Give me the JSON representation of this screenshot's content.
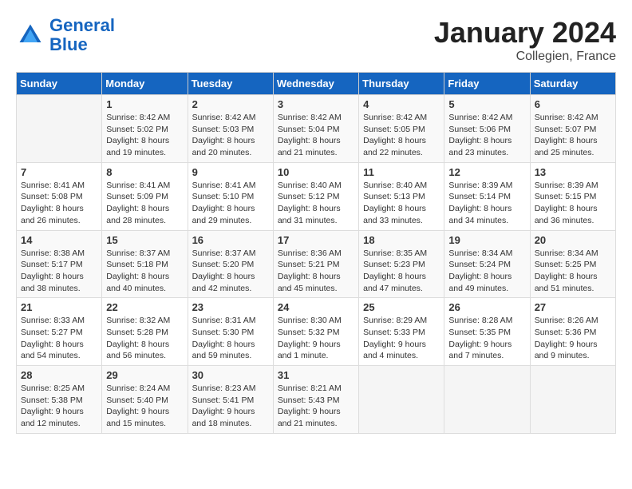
{
  "header": {
    "logo_line1": "General",
    "logo_line2": "Blue",
    "month_year": "January 2024",
    "location": "Collegien, France"
  },
  "days_of_week": [
    "Sunday",
    "Monday",
    "Tuesday",
    "Wednesday",
    "Thursday",
    "Friday",
    "Saturday"
  ],
  "weeks": [
    [
      {
        "day": "",
        "sunrise": "",
        "sunset": "",
        "daylight": ""
      },
      {
        "day": "1",
        "sunrise": "Sunrise: 8:42 AM",
        "sunset": "Sunset: 5:02 PM",
        "daylight": "Daylight: 8 hours and 19 minutes."
      },
      {
        "day": "2",
        "sunrise": "Sunrise: 8:42 AM",
        "sunset": "Sunset: 5:03 PM",
        "daylight": "Daylight: 8 hours and 20 minutes."
      },
      {
        "day": "3",
        "sunrise": "Sunrise: 8:42 AM",
        "sunset": "Sunset: 5:04 PM",
        "daylight": "Daylight: 8 hours and 21 minutes."
      },
      {
        "day": "4",
        "sunrise": "Sunrise: 8:42 AM",
        "sunset": "Sunset: 5:05 PM",
        "daylight": "Daylight: 8 hours and 22 minutes."
      },
      {
        "day": "5",
        "sunrise": "Sunrise: 8:42 AM",
        "sunset": "Sunset: 5:06 PM",
        "daylight": "Daylight: 8 hours and 23 minutes."
      },
      {
        "day": "6",
        "sunrise": "Sunrise: 8:42 AM",
        "sunset": "Sunset: 5:07 PM",
        "daylight": "Daylight: 8 hours and 25 minutes."
      }
    ],
    [
      {
        "day": "7",
        "sunrise": "Sunrise: 8:41 AM",
        "sunset": "Sunset: 5:08 PM",
        "daylight": "Daylight: 8 hours and 26 minutes."
      },
      {
        "day": "8",
        "sunrise": "Sunrise: 8:41 AM",
        "sunset": "Sunset: 5:09 PM",
        "daylight": "Daylight: 8 hours and 28 minutes."
      },
      {
        "day": "9",
        "sunrise": "Sunrise: 8:41 AM",
        "sunset": "Sunset: 5:10 PM",
        "daylight": "Daylight: 8 hours and 29 minutes."
      },
      {
        "day": "10",
        "sunrise": "Sunrise: 8:40 AM",
        "sunset": "Sunset: 5:12 PM",
        "daylight": "Daylight: 8 hours and 31 minutes."
      },
      {
        "day": "11",
        "sunrise": "Sunrise: 8:40 AM",
        "sunset": "Sunset: 5:13 PM",
        "daylight": "Daylight: 8 hours and 33 minutes."
      },
      {
        "day": "12",
        "sunrise": "Sunrise: 8:39 AM",
        "sunset": "Sunset: 5:14 PM",
        "daylight": "Daylight: 8 hours and 34 minutes."
      },
      {
        "day": "13",
        "sunrise": "Sunrise: 8:39 AM",
        "sunset": "Sunset: 5:15 PM",
        "daylight": "Daylight: 8 hours and 36 minutes."
      }
    ],
    [
      {
        "day": "14",
        "sunrise": "Sunrise: 8:38 AM",
        "sunset": "Sunset: 5:17 PM",
        "daylight": "Daylight: 8 hours and 38 minutes."
      },
      {
        "day": "15",
        "sunrise": "Sunrise: 8:37 AM",
        "sunset": "Sunset: 5:18 PM",
        "daylight": "Daylight: 8 hours and 40 minutes."
      },
      {
        "day": "16",
        "sunrise": "Sunrise: 8:37 AM",
        "sunset": "Sunset: 5:20 PM",
        "daylight": "Daylight: 8 hours and 42 minutes."
      },
      {
        "day": "17",
        "sunrise": "Sunrise: 8:36 AM",
        "sunset": "Sunset: 5:21 PM",
        "daylight": "Daylight: 8 hours and 45 minutes."
      },
      {
        "day": "18",
        "sunrise": "Sunrise: 8:35 AM",
        "sunset": "Sunset: 5:23 PM",
        "daylight": "Daylight: 8 hours and 47 minutes."
      },
      {
        "day": "19",
        "sunrise": "Sunrise: 8:34 AM",
        "sunset": "Sunset: 5:24 PM",
        "daylight": "Daylight: 8 hours and 49 minutes."
      },
      {
        "day": "20",
        "sunrise": "Sunrise: 8:34 AM",
        "sunset": "Sunset: 5:25 PM",
        "daylight": "Daylight: 8 hours and 51 minutes."
      }
    ],
    [
      {
        "day": "21",
        "sunrise": "Sunrise: 8:33 AM",
        "sunset": "Sunset: 5:27 PM",
        "daylight": "Daylight: 8 hours and 54 minutes."
      },
      {
        "day": "22",
        "sunrise": "Sunrise: 8:32 AM",
        "sunset": "Sunset: 5:28 PM",
        "daylight": "Daylight: 8 hours and 56 minutes."
      },
      {
        "day": "23",
        "sunrise": "Sunrise: 8:31 AM",
        "sunset": "Sunset: 5:30 PM",
        "daylight": "Daylight: 8 hours and 59 minutes."
      },
      {
        "day": "24",
        "sunrise": "Sunrise: 8:30 AM",
        "sunset": "Sunset: 5:32 PM",
        "daylight": "Daylight: 9 hours and 1 minute."
      },
      {
        "day": "25",
        "sunrise": "Sunrise: 8:29 AM",
        "sunset": "Sunset: 5:33 PM",
        "daylight": "Daylight: 9 hours and 4 minutes."
      },
      {
        "day": "26",
        "sunrise": "Sunrise: 8:28 AM",
        "sunset": "Sunset: 5:35 PM",
        "daylight": "Daylight: 9 hours and 7 minutes."
      },
      {
        "day": "27",
        "sunrise": "Sunrise: 8:26 AM",
        "sunset": "Sunset: 5:36 PM",
        "daylight": "Daylight: 9 hours and 9 minutes."
      }
    ],
    [
      {
        "day": "28",
        "sunrise": "Sunrise: 8:25 AM",
        "sunset": "Sunset: 5:38 PM",
        "daylight": "Daylight: 9 hours and 12 minutes."
      },
      {
        "day": "29",
        "sunrise": "Sunrise: 8:24 AM",
        "sunset": "Sunset: 5:40 PM",
        "daylight": "Daylight: 9 hours and 15 minutes."
      },
      {
        "day": "30",
        "sunrise": "Sunrise: 8:23 AM",
        "sunset": "Sunset: 5:41 PM",
        "daylight": "Daylight: 9 hours and 18 minutes."
      },
      {
        "day": "31",
        "sunrise": "Sunrise: 8:21 AM",
        "sunset": "Sunset: 5:43 PM",
        "daylight": "Daylight: 9 hours and 21 minutes."
      },
      {
        "day": "",
        "sunrise": "",
        "sunset": "",
        "daylight": ""
      },
      {
        "day": "",
        "sunrise": "",
        "sunset": "",
        "daylight": ""
      },
      {
        "day": "",
        "sunrise": "",
        "sunset": "",
        "daylight": ""
      }
    ]
  ]
}
